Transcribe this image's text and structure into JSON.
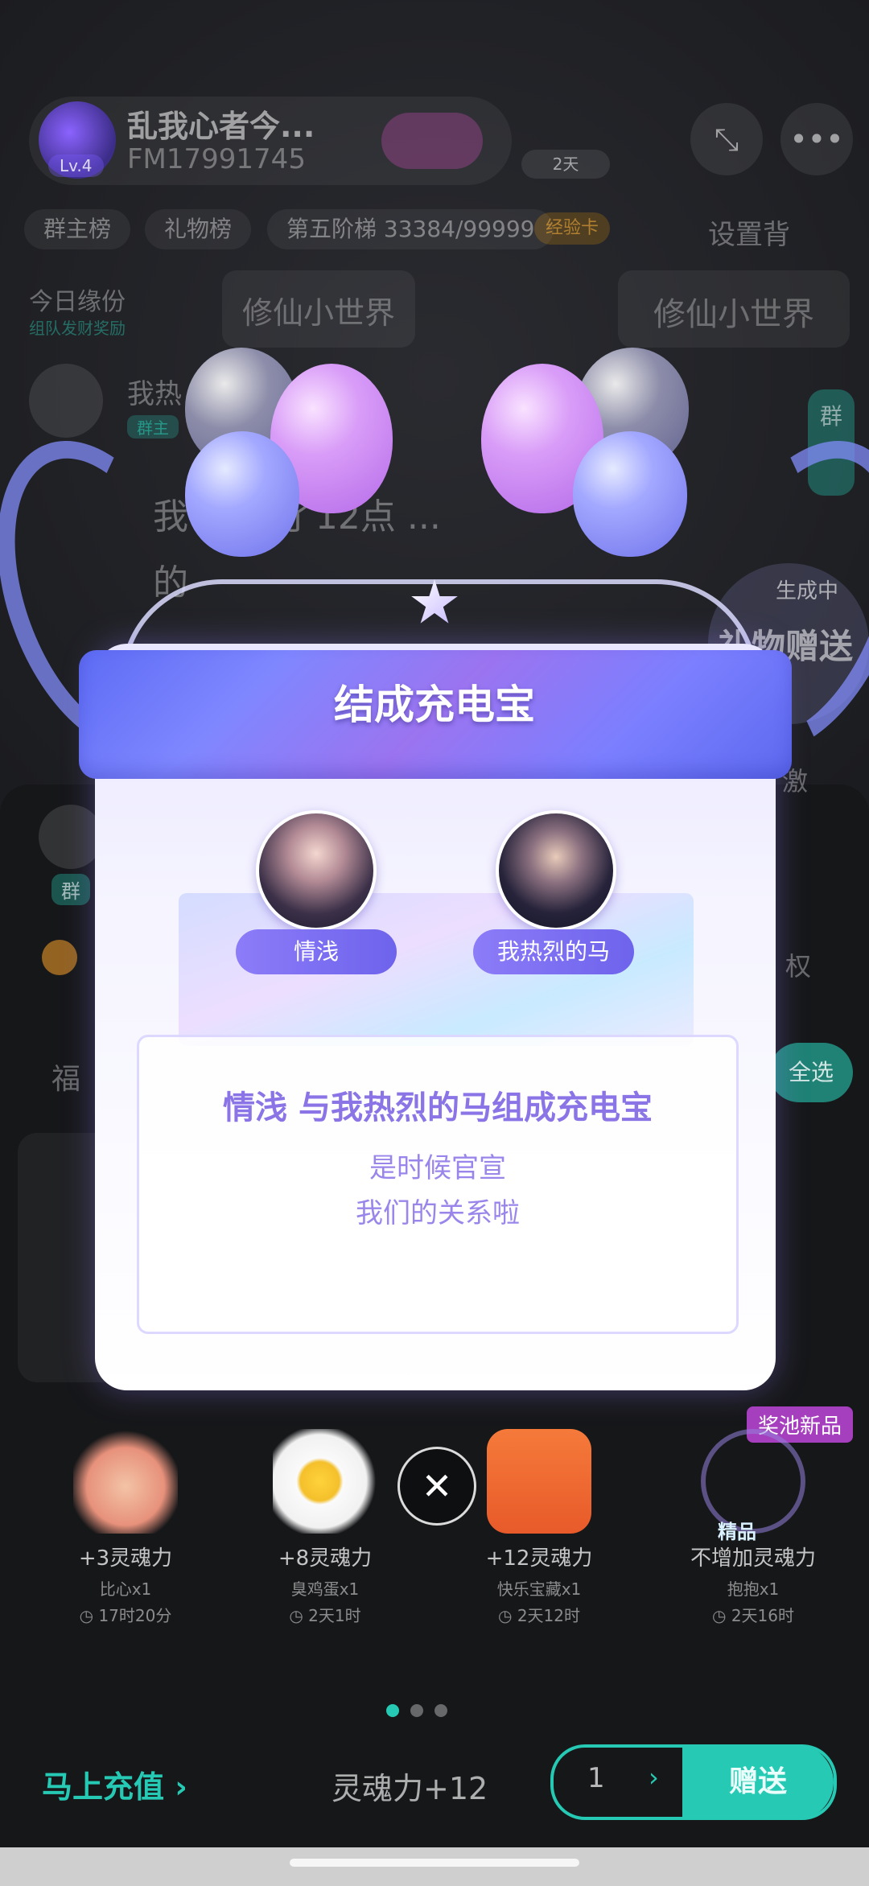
{
  "room": {
    "title": "乱我心者今...",
    "id": "FM17991745",
    "level": "Lv.4",
    "days": "2天",
    "chips": [
      "群主榜",
      "礼物榜",
      "第五阶梯 33384/99999"
    ],
    "level_card": "经验卡",
    "settings_label": "设置背",
    "today_label": "今日缘份",
    "today_sub": "组队发财奖励",
    "world_banner": "修仙小世界",
    "owner_name": "我热",
    "owner_badge": "群主",
    "chat_line1": "我 ... 到了12点 ...",
    "chat_line2": "的",
    "side_badge_top": "群",
    "live_status": "生成中",
    "live_gift": "礼物赠送",
    "welfare": "福",
    "select_all": "全选",
    "right_label": "权",
    "more_label": "激"
  },
  "popup": {
    "title": "结成充电宝",
    "user_a": "情浅",
    "user_b": "我热烈的马",
    "message_line1": "情浅 与我热烈的马组成充电宝",
    "message_line2": "是时候官宣",
    "message_line3": "我们的关系啦"
  },
  "gifts": [
    {
      "power": "+3灵魂力",
      "name": "比心x1",
      "time": "17时20分"
    },
    {
      "power": "+8灵魂力",
      "name": "臭鸡蛋x1",
      "time": "2天1时"
    },
    {
      "power": "+12灵魂力",
      "name": "快乐宝藏x1",
      "time": "2天12时"
    },
    {
      "power": "不增加灵魂力",
      "name": "抱抱x1",
      "time": "2天16时"
    }
  ],
  "pool_badge": "奖池新品",
  "premium_label": "精品",
  "bottom": {
    "recharge": "马上充值 ›",
    "soul_total": "灵魂力+12",
    "quantity": "1",
    "quantity_arrow": "›",
    "send": "赠送"
  },
  "colors": {
    "accent": "#26c9b3",
    "ribbon": "#7b7fff",
    "popup_text": "#8a74e6"
  },
  "icons": {
    "close": "close-icon",
    "clock": "clock-icon"
  }
}
